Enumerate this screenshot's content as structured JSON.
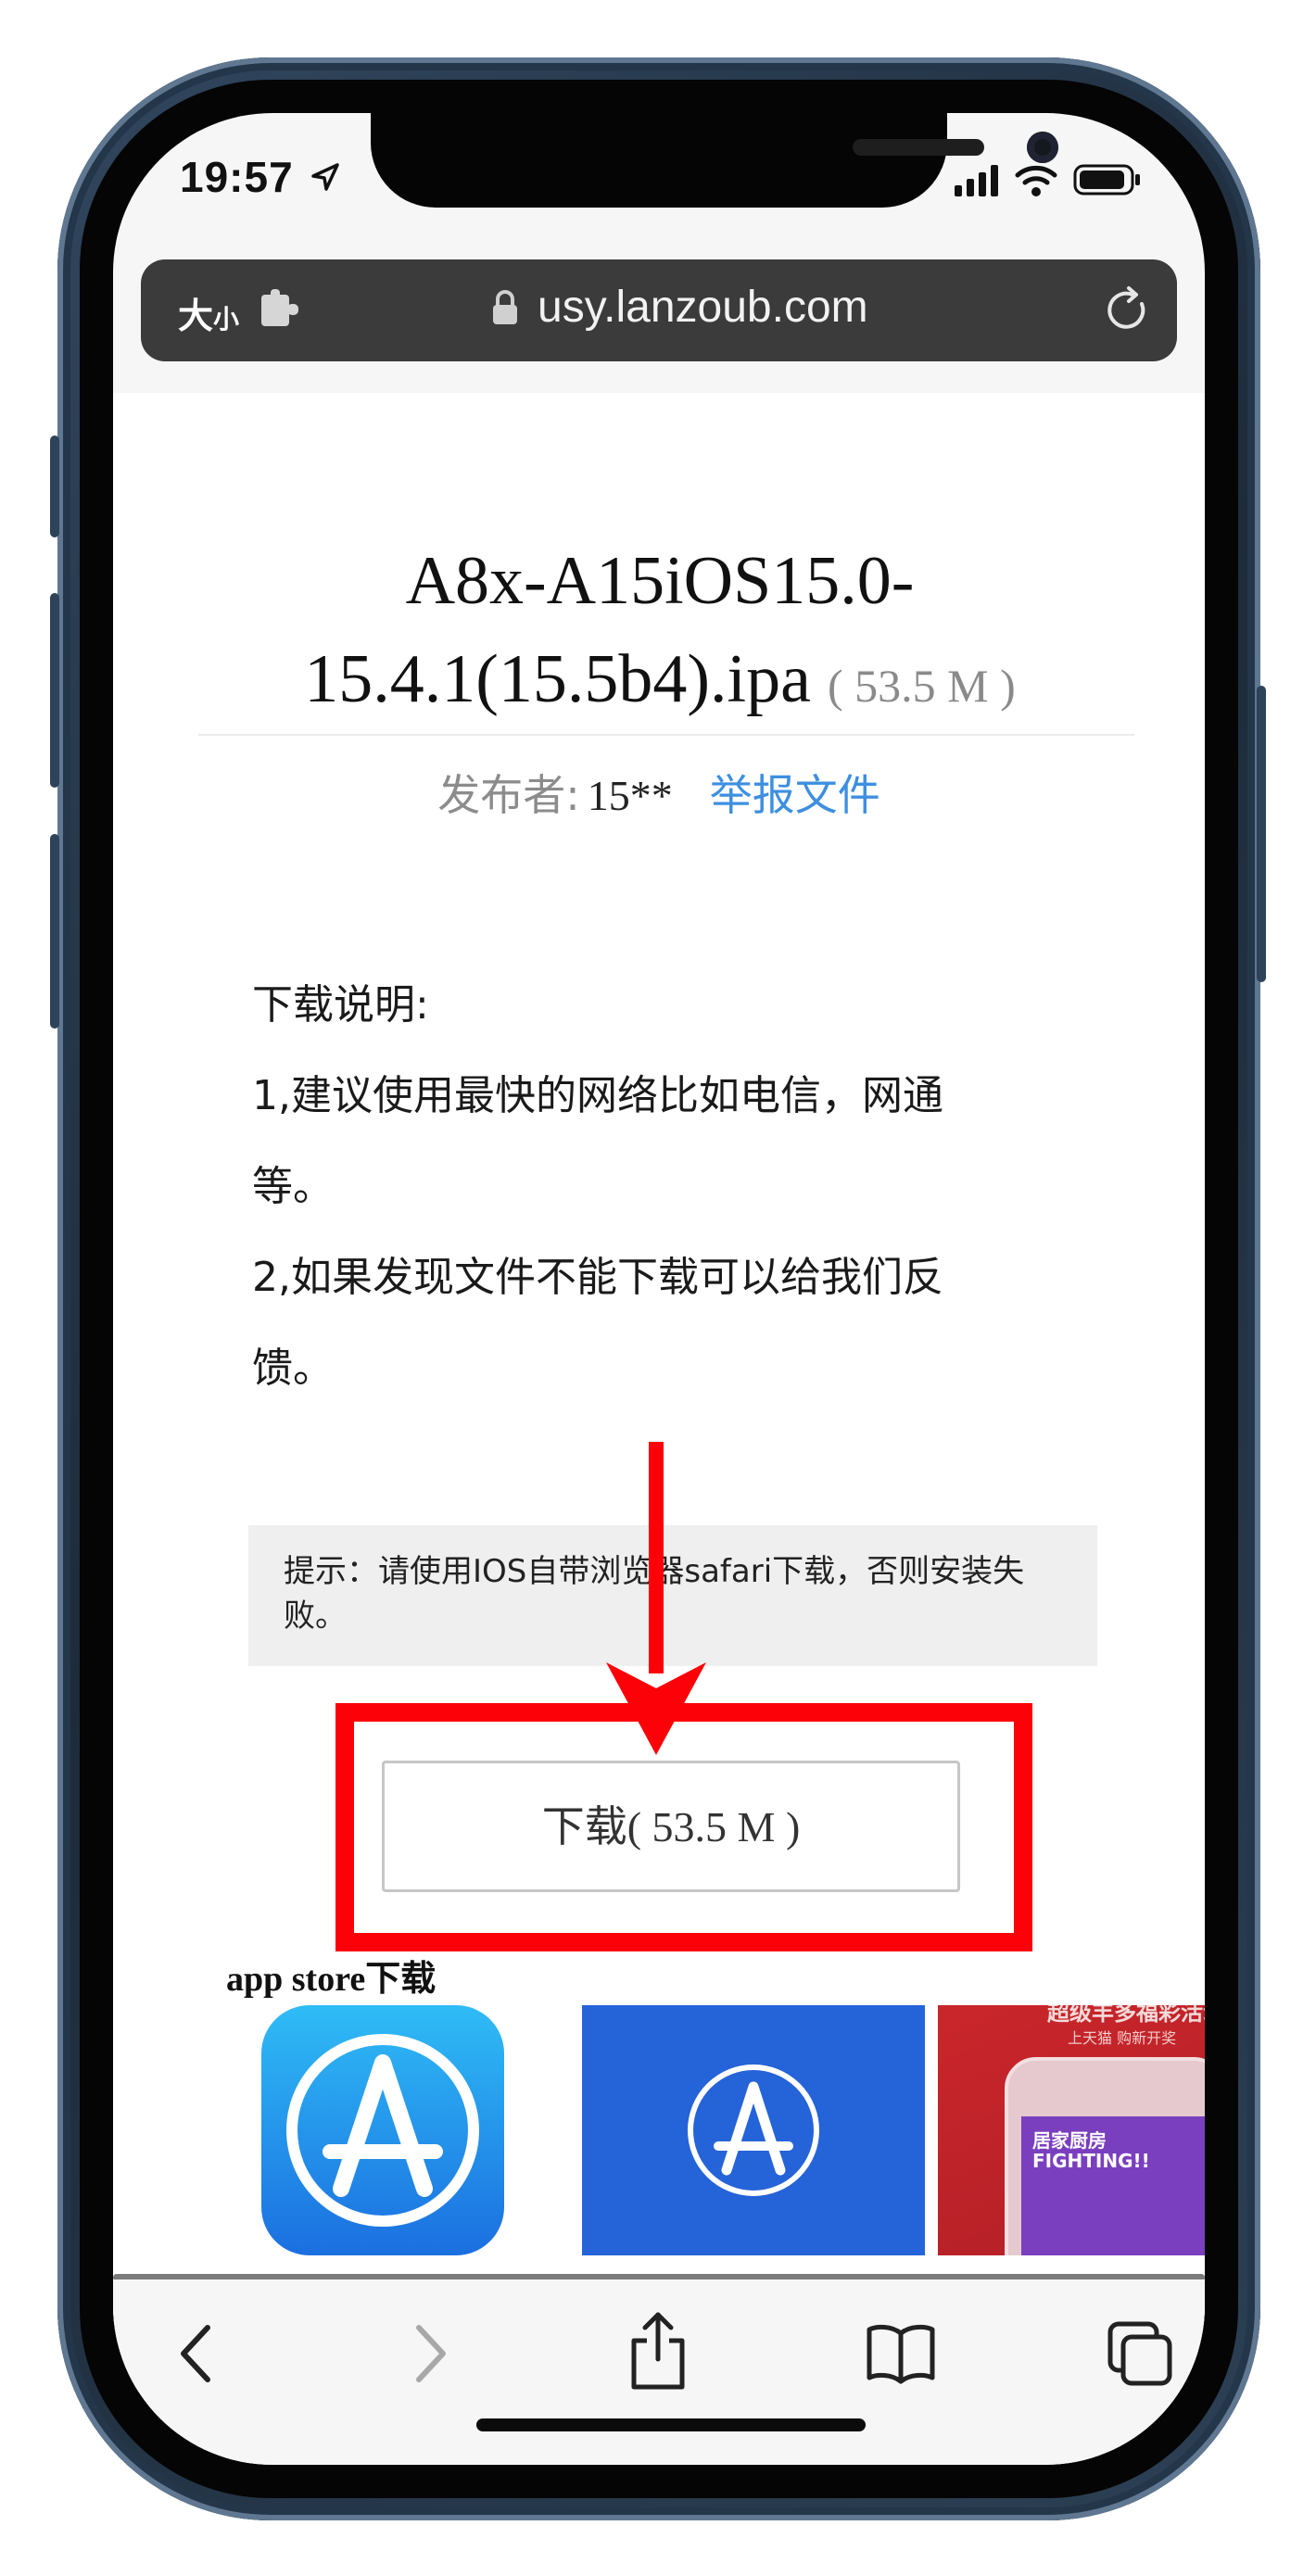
{
  "status_bar": {
    "time": "19:57"
  },
  "url_bar": {
    "text_size_label_big": "大",
    "text_size_label_small": "小",
    "domain": "usy.lanzoub.com"
  },
  "page": {
    "title_line1": "A8x-A15iOS15.0-",
    "title_line2": "15.4.1(15.5b4).ipa",
    "file_size": "( 53.5 M )",
    "publisher_label": "发布者:",
    "publisher_value": "15**",
    "report_link": "举报文件",
    "instructions": {
      "heading": "下载说明:",
      "line1": "1,建议使用最快的网络比如电信，网通",
      "line1_cont": "等。",
      "line2": "2,如果发现文件不能下载可以给我们反",
      "line2_cont": "馈。"
    },
    "tip": "提示：请使用IOS自带浏览器safari下载，否则安装失败。",
    "download_button": {
      "label": "下载",
      "size": "( 53.5 M )"
    },
    "appstore_heading": "app store下载",
    "thumb3_text": {
      "banner": "超级丰多福彩活动",
      "sub": "上天猫 购新开奖",
      "screen_title": "FIGHTING!!",
      "screen_sub": "居家厨房"
    }
  },
  "colors": {
    "highlight_red": "#fc0107",
    "link_blue": "#3d8fe0",
    "appstore_blue": "#2563d8"
  }
}
